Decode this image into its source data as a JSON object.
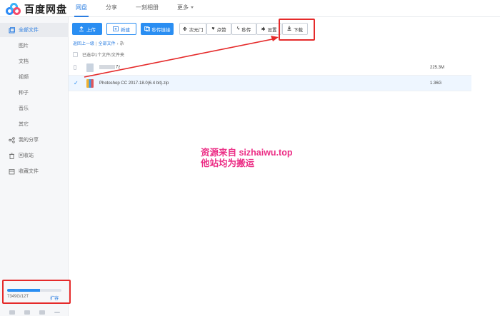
{
  "app": {
    "name": "百度网盘"
  },
  "nav": {
    "items": [
      {
        "label": "网盘",
        "active": true
      },
      {
        "label": "分享",
        "active": false
      },
      {
        "label": "一刻相册",
        "active": false
      },
      {
        "label": "更多",
        "active": false
      }
    ]
  },
  "sidebar": {
    "items": [
      {
        "label": "全部文件",
        "icon": "folder-icon",
        "active": true
      },
      {
        "label": "图片"
      },
      {
        "label": "文档"
      },
      {
        "label": "视频"
      },
      {
        "label": "种子"
      },
      {
        "label": "音乐"
      },
      {
        "label": "其它"
      },
      {
        "label": "我的分享",
        "icon": "share-icon"
      },
      {
        "label": "回收站",
        "icon": "trash-icon"
      },
      {
        "label": "收藏文件",
        "icon": "collection-icon"
      }
    ],
    "quota": {
      "text": "7349G/12T",
      "expand_label": "扩容",
      "used_fraction": 0.6
    }
  },
  "toolbar": {
    "upload": "上传",
    "new_folder": "新建",
    "quick_link": "秒传链接",
    "ciyuanmen": "次元门",
    "like": "点赞",
    "miaochuan": "秒传",
    "settings": "设置",
    "download": "下载"
  },
  "breadcrumb": {
    "back": "返回上一级",
    "all": "全部文件",
    "current": "杂"
  },
  "selection": {
    "info": "已选中1个文件/文件夹"
  },
  "files": [
    {
      "name": "7z",
      "size": "225.3M",
      "type": "archive-cloud-icon",
      "selected": false
    },
    {
      "name": "Photoshop CC 2017-18.0(6.4 bit).zip",
      "size": "1.36G",
      "type": "zip-icon",
      "selected": true
    }
  ],
  "watermark": {
    "line1": "资源来自 sizhaiwu.top",
    "line2": "他站均为搬运"
  },
  "colors": {
    "accent": "#2a8ef2",
    "annotation_red": "#e52a2a",
    "watermark": "#ec2f86"
  }
}
